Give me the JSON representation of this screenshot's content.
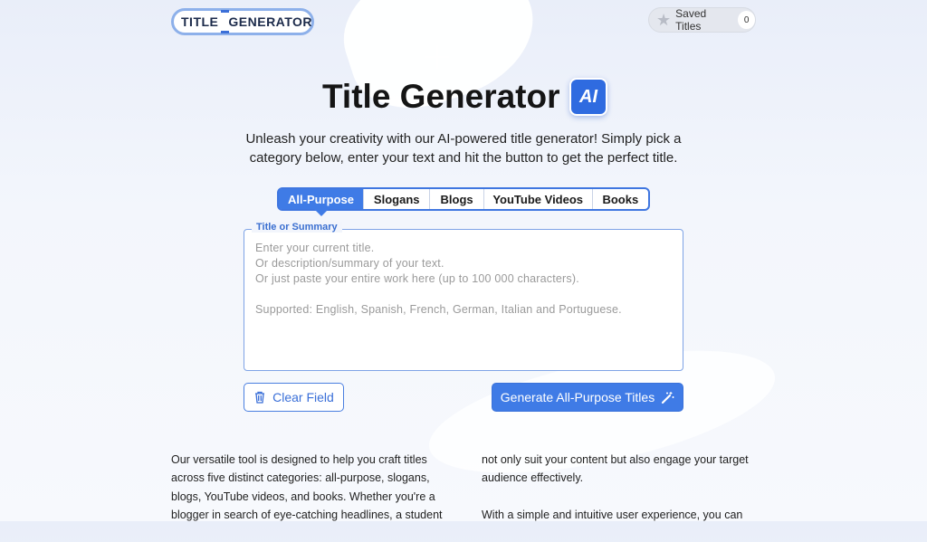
{
  "header": {
    "logo_word1": "TITLE",
    "logo_word2": "GENERATOR",
    "saved_label": "Saved Titles",
    "saved_count": "0"
  },
  "hero": {
    "title": "Title Generator",
    "badge": "AI",
    "subtitle": "Unleash your creativity with our AI-powered title generator! Simply pick a category below, enter your text and hit the button to get the perfect title."
  },
  "tabs": [
    {
      "label": "All-Purpose",
      "active": true
    },
    {
      "label": "Slogans",
      "active": false
    },
    {
      "label": "Blogs",
      "active": false
    },
    {
      "label": "YouTube Videos",
      "active": false
    },
    {
      "label": "Books",
      "active": false
    }
  ],
  "field": {
    "legend": "Title or Summary",
    "value": "",
    "placeholder": "Enter your current title.\nOr description/summary of your text.\nOr just paste your entire work here (up to 100 000 characters).\n\nSupported: English, Spanish, French, German, Italian and Portuguese."
  },
  "actions": {
    "clear_label": "Clear Field",
    "generate_label": "Generate All-Purpose Titles"
  },
  "description": {
    "col1": "Our versatile tool is designed to help you craft titles across five distinct categories: all-purpose, slogans, blogs, YouTube videos, and books. Whether you're a blogger in search of eye-catching headlines, a student",
    "col2_p1": "not only suit your content but also engage your target audience effectively.",
    "col2_p2": "With a simple and intuitive user experience, you can"
  },
  "colors": {
    "accent": "#3f7be6",
    "logo_border": "#8db0ea",
    "badge_bg": "#2f6be0"
  },
  "icons": [
    "star-icon",
    "trash-icon",
    "magic-wand-icon"
  ]
}
